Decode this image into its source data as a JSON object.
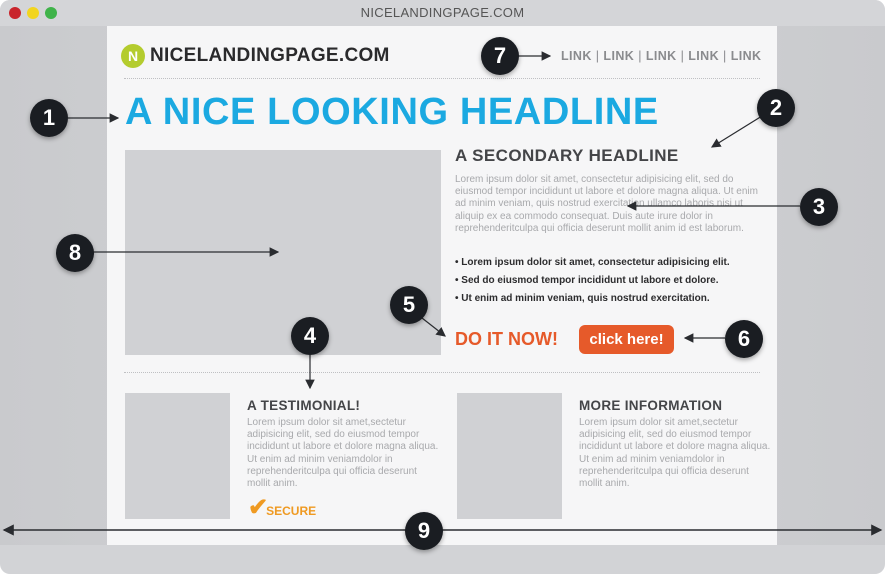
{
  "window": {
    "title": "NICELANDINGPAGE.COM",
    "controls": [
      "close",
      "minimize",
      "maximize"
    ]
  },
  "page": {
    "logo": {
      "badge": "N",
      "text": "NICELANDINGPAGE.COM",
      "badge_color": "#b4cc2e"
    },
    "nav": {
      "links": [
        "LINK",
        "LINK",
        "LINK",
        "LINK",
        "LINK"
      ],
      "separator": "|"
    },
    "headline": "A NICE LOOKING HEADLINE",
    "headline_color": "#1ba9e1",
    "secondary_headline": "A SECONDARY HEADLINE",
    "body_paragraph": "Lorem ipsum dolor sit amet, consectetur adipisicing elit, sed do eiusmod tempor incididunt ut labore et dolore magna aliqua. Ut enim ad minim veniam, quis nostrud exercitation ullamco laboris nisi ut aliquip ex ea commodo consequat. Duis aute irure dolor in reprehenderitculpa qui officia deserunt mollit anim id est laborum.",
    "bullets": [
      "• Lorem ipsum dolor sit amet, consectetur adipisicing elit.",
      "• Sed do eiusmod tempor incididunt ut labore et dolore.",
      "• Ut enim ad minim veniam, quis nostrud exercitation."
    ],
    "cta": {
      "text": "DO IT NOW!",
      "button_label": "click here!",
      "color": "#e65a2a"
    },
    "testimonial": {
      "title": "A TESTIMONIAL!",
      "text": "Lorem ipsum dolor sit amet,sectetur adipisicing elit, sed do eiusmod tempor incididunt ut labore et dolore magna aliqua. Ut enim ad minim veniamdolor in reprehenderitculpa qui officia deserunt mollit anim.",
      "badge": "SECURE",
      "badge_icon": "checkmark-icon",
      "badge_color": "#ef9a22"
    },
    "more_info": {
      "title": "MORE INFORMATION",
      "text": "Lorem ipsum dolor sit amet,sectetur adipisicing elit, sed do eiusmod tempor incididunt ut labore et dolore magna aliqua. Ut enim ad minim veniamdolor in reprehenderitculpa qui officia deserunt mollit anim."
    }
  },
  "callouts": [
    "1",
    "2",
    "3",
    "4",
    "5",
    "6",
    "7",
    "8",
    "9"
  ]
}
